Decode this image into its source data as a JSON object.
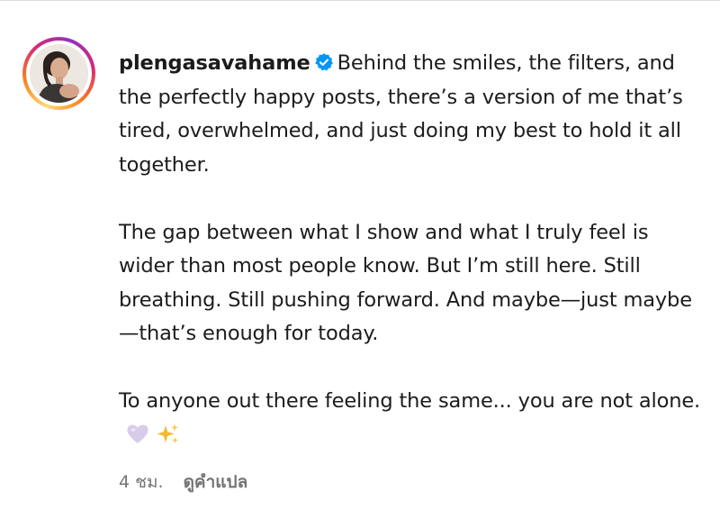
{
  "post": {
    "username": "plengasavahame",
    "verified": true,
    "caption_first_line": "Behind the smiles, the filters, and the perfectly happy posts, there’s a version of me that’s tired, overwhelmed, and just doing my best to hold it all together.",
    "caption_paragraph_2": "The gap between what I show and what I truly feel is wider than most people know. But I’m still here. Still breathing. Still pushing forward. And maybe—just maybe—that’s enough for today.",
    "caption_paragraph_3": "To anyone out there feeling the same... you are not alone.",
    "emojis": [
      "light-purple-heart-icon",
      "sparkles-icon"
    ],
    "time_ago": "4 ชม.",
    "translate_label": "ดูคำแปล"
  },
  "colors": {
    "text": "#1c1c1c",
    "meta_text": "#737373",
    "verified_badge": "#0095f6",
    "story_ring": [
      "#feda75",
      "#fa7e1e",
      "#d62976",
      "#962fbf"
    ]
  }
}
